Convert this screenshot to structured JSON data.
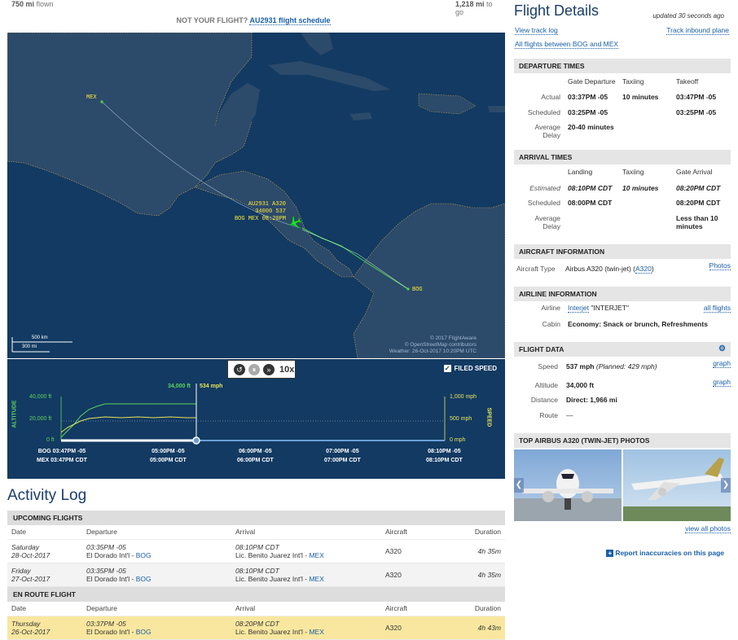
{
  "top": {
    "flown_val": "750 mi",
    "flown_label": "flown",
    "togo_val": "1,218 mi",
    "togo_label": "to go"
  },
  "not_your": {
    "prefix": "NOT YOUR FLIGHT?",
    "link": "AU2931 flight schedule"
  },
  "map": {
    "label_mex": "MEX",
    "label_bog": "BOG",
    "tag1": "AU2931 A320",
    "tag2": "34000 537",
    "tag3": "BOG MEX 08:20PM",
    "scale1": "500 km",
    "scale2": "300 mi",
    "credit1": "© 2017 FlightAware",
    "credit2": "© OpenStreetMap contributors",
    "credit3": "Weather: 26-Oct-2017 10:20PM UTC",
    "accent": "#123a62"
  },
  "graph": {
    "speed_label": "10x",
    "filed_speed": "FILED SPEED",
    "alt_axis": "ALTITUDE",
    "spd_axis": "SPEED",
    "alt_current": "34,000 ft",
    "spd_current": "534 mph",
    "alt_ticks": [
      "40,000 ft",
      "20,000 ft",
      "0 ft"
    ],
    "spd_ticks": [
      "1,000 mph",
      "500 mph",
      "0 mph"
    ],
    "times_top": [
      "BOG 03:47PM -05",
      "05:00PM -05",
      "06:00PM -05",
      "07:00PM -05",
      "08:10PM -05"
    ],
    "times_bot": [
      "MEX 03:47PM CDT",
      "05:00PM CDT",
      "06:00PM CDT",
      "07:00PM CDT",
      "08:10PM CDT"
    ],
    "altitude_color": "#5fd35f",
    "speed_color": "#e8e35a",
    "progress": 0.33
  },
  "activity": {
    "title": "Activity Log",
    "upcoming_title": "UPCOMING FLIGHTS",
    "enroute_title": "EN ROUTE FLIGHT",
    "cols": [
      "Date",
      "Departure",
      "Arrival",
      "Aircraft",
      "Duration"
    ],
    "upcoming": [
      {
        "day": "Saturday",
        "date": "28-Oct-2017",
        "dep_time": "03:35PM -05",
        "dep_place": "El Dorado Int'l -",
        "dep_code": "BOG",
        "arr_time": "08:10PM CDT",
        "arr_place": "Lic. Benito Juarez Int'l -",
        "arr_code": "MEX",
        "aircraft": "A320",
        "duration": "4h 35m"
      },
      {
        "day": "Friday",
        "date": "27-Oct-2017",
        "dep_time": "03:35PM -05",
        "dep_place": "El Dorado Int'l -",
        "dep_code": "BOG",
        "arr_time": "08:10PM CDT",
        "arr_place": "Lic. Benito Juarez Int'l -",
        "arr_code": "MEX",
        "aircraft": "A320",
        "duration": "4h 35m"
      }
    ],
    "enroute": [
      {
        "day": "Thursday",
        "date": "26-Oct-2017",
        "dep_time": "03:37PM -05",
        "dep_place": "El Dorado Int'l -",
        "dep_code": "BOG",
        "arr_time": "08:20PM CDT",
        "arr_place": "Lic. Benito Juarez Int'l -",
        "arr_code": "MEX",
        "aircraft": "A320",
        "duration": "4h 43m"
      }
    ]
  },
  "details": {
    "title": "Flight Details",
    "updated": "updated 30 seconds ago",
    "view_track": "View track log",
    "track_inbound": "Track inbound plane",
    "all_flights": "All flights between BOG and MEX",
    "dep_title": "DEPARTURE TIMES",
    "dep_cols": [
      "Gate Departure",
      "Taxiing",
      "Takeoff"
    ],
    "dep_actual_label": "Actual",
    "dep_actual": [
      "03:37PM -05",
      "10 minutes",
      "03:47PM -05"
    ],
    "dep_sched_label": "Scheduled",
    "dep_sched": [
      "03:25PM -05",
      "",
      "03:25PM -05"
    ],
    "dep_avg_label1": "Average",
    "dep_avg_label2": "Delay",
    "dep_avg": "20-40 minutes",
    "arr_title": "ARRIVAL TIMES",
    "arr_cols": [
      "Landing",
      "Taxiing",
      "Gate Arrival"
    ],
    "arr_est_label": "Estimated",
    "arr_est": [
      "08:10PM CDT",
      "10 minutes",
      "08:20PM CDT"
    ],
    "arr_sched_label": "Scheduled",
    "arr_sched": [
      "08:00PM CDT",
      "",
      "08:20PM CDT"
    ],
    "arr_avg_label1": "Average",
    "arr_avg_label2": "Delay",
    "arr_avg1": "Less than 10",
    "arr_avg2": "minutes",
    "ac_title": "AIRCRAFT INFORMATION",
    "ac_label": "Aircraft Type",
    "ac_value": "Airbus A320 (twin-jet) (",
    "ac_link": "A320",
    "ac_close": ")",
    "photos_link": "Photos",
    "al_title": "AIRLINE INFORMATION",
    "al_label": "Airline",
    "al_link": "Interjet",
    "al_value": "\"INTERJET\"",
    "all_flights_link": "all flights",
    "cabin_label": "Cabin",
    "cabin_value": "Economy: Snack or brunch, Refreshments",
    "fd_title": "FLIGHT DATA",
    "speed_label": "Speed",
    "speed_value": "537 mph",
    "speed_planned": "(Planned: 429 mph)",
    "graph_link": "graph",
    "alt_label": "Altitude",
    "alt_value": "34,000 ft",
    "dist_label": "Distance",
    "dist_value": "Direct: 1,966 mi",
    "route_label": "Route",
    "route_value": "—",
    "photos_title": "TOP AIRBUS A320 (TWIN-JET) PHOTOS",
    "view_all": "view all photos",
    "report": "Report inaccuracies on this page"
  }
}
